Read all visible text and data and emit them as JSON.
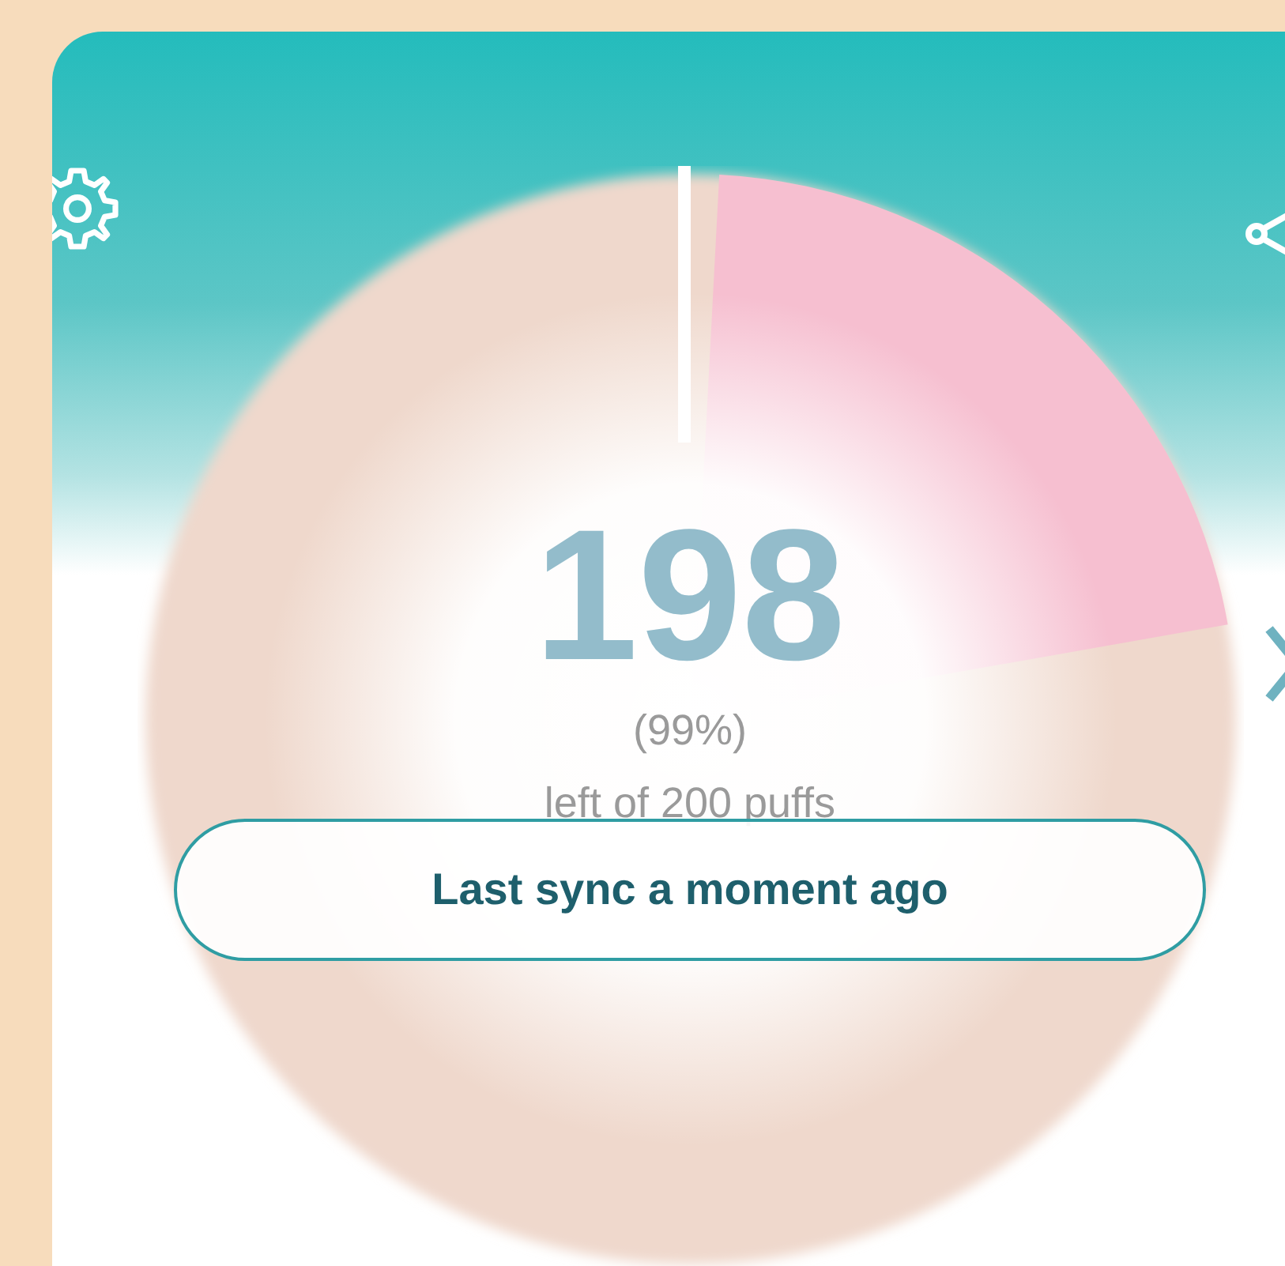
{
  "dose_counter": {
    "remaining": "198",
    "percent": "(99%)",
    "caption": "left of 200 puffs"
  },
  "sync_button": {
    "label": "Last sync a moment ago"
  }
}
